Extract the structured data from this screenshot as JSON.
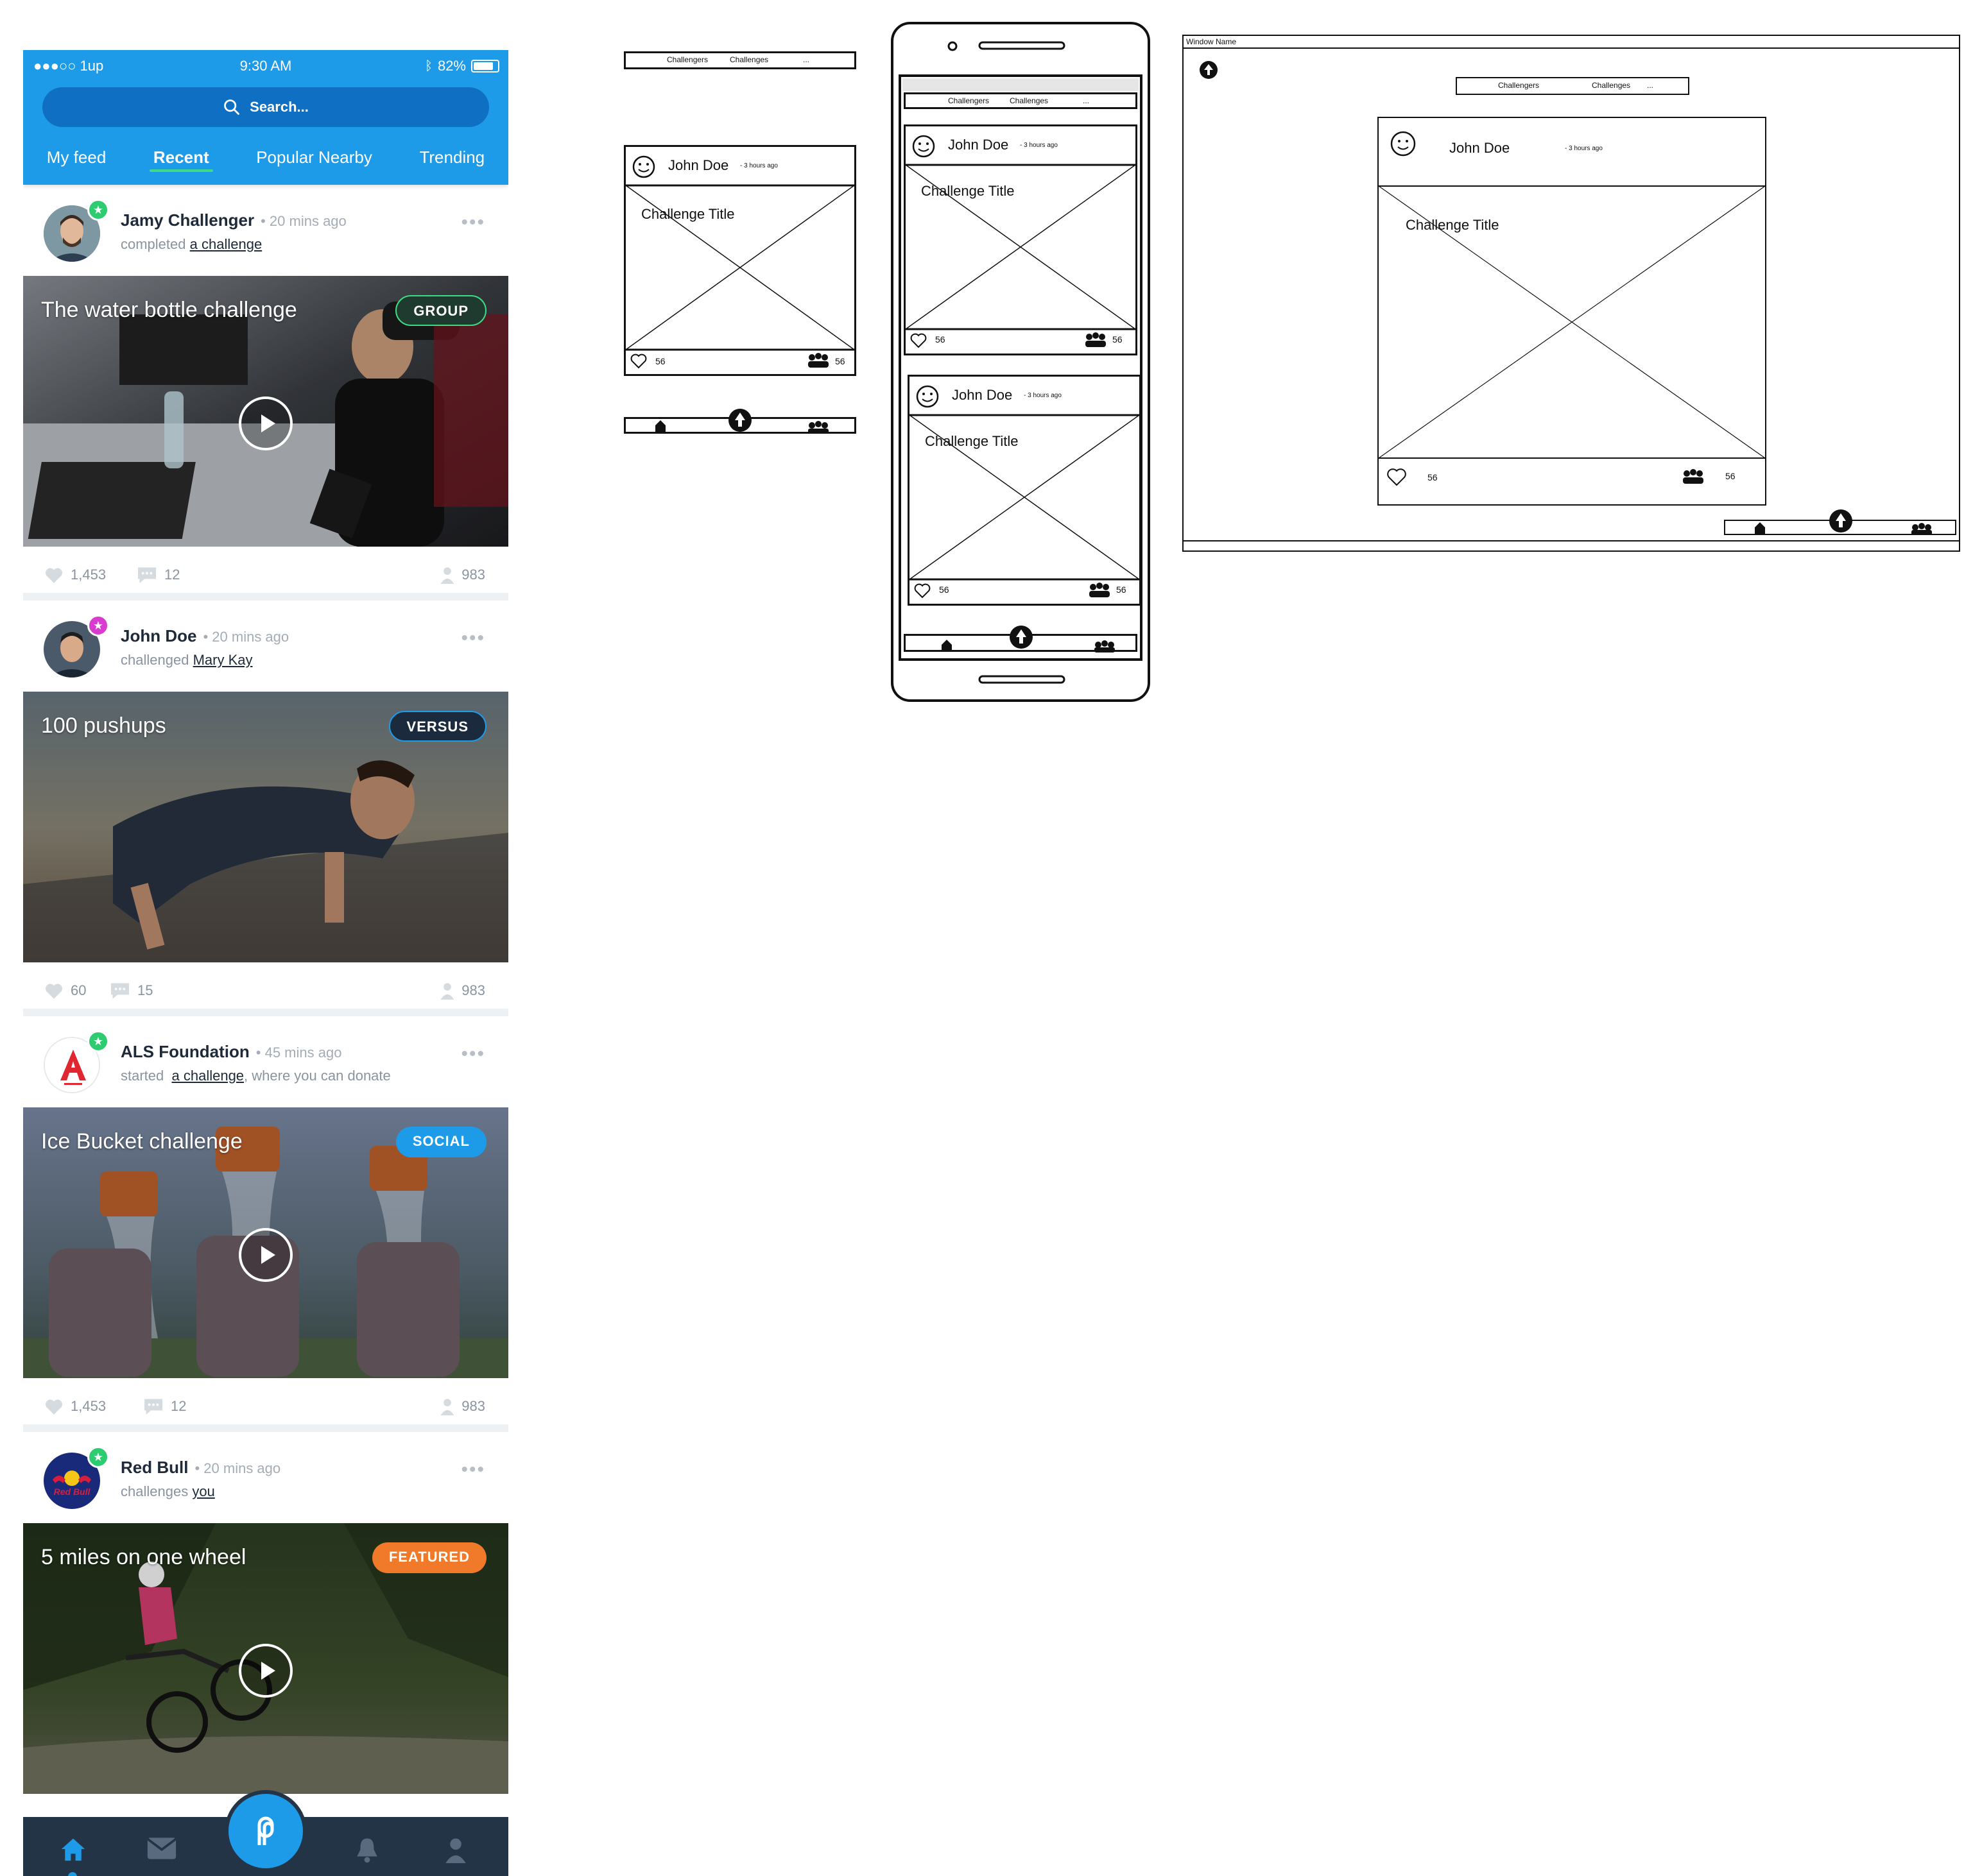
{
  "status_bar": {
    "carrier": "●●●○○ 1up",
    "time": "9:30 AM",
    "battery": "82%",
    "battery_level": 0.82
  },
  "search": {
    "placeholder": "Search..."
  },
  "tabs": [
    {
      "label": "My feed"
    },
    {
      "label": "Recent",
      "active": true
    },
    {
      "label": "Popular Nearby"
    },
    {
      "label": "Trending"
    }
  ],
  "posts": [
    {
      "name": "Jamy Challenger",
      "time": "20 mins ago",
      "action_prefix": "completed",
      "action_link": "a challenge",
      "action_suffix": "",
      "title": "The water bottle challenge",
      "tag": "GROUP",
      "tag_color": "#1f3a2e",
      "likes": "1,453",
      "comments": "12",
      "participants": "983",
      "badge_color": "#2ecc71"
    },
    {
      "name": "John Doe",
      "time": "20 mins ago",
      "action_prefix": "challenged",
      "action_link": "Mary Kay",
      "action_suffix": "",
      "title": "100 pushups",
      "tag": "VERSUS",
      "tag_color": "#1b2a3d",
      "likes": "60",
      "comments": "15",
      "participants": "983",
      "badge_color": "#d93bd0"
    },
    {
      "name": "ALS Foundation",
      "time": "45 mins ago",
      "action_prefix": "started",
      "action_link": "a challenge",
      "action_suffix": ", where you can donate",
      "title": "Ice Bucket challenge",
      "tag": "SOCIAL",
      "tag_color": "#1e9be8",
      "likes": "1,453",
      "comments": "12",
      "participants": "983",
      "badge_color": "#2ecc71"
    },
    {
      "name": "Red Bull",
      "time": "20 mins ago",
      "action_prefix": "challenges",
      "action_link": "you",
      "action_suffix": "",
      "title": "5 miles on one wheel",
      "tag": "FEATURED",
      "tag_color": "#f07a2a",
      "badge_color": "#2ecc71"
    }
  ],
  "nav": {
    "items": [
      "home-icon",
      "mail-icon",
      "challenge-fab-icon",
      "bell-icon",
      "profile-icon"
    ]
  },
  "wireframes": {
    "tabs": {
      "challengers": "Challengers",
      "challenges": "Challenges",
      "more": "..."
    },
    "card": {
      "user": "John Doe",
      "time": "- 3 hours ago",
      "title": "Challenge Title",
      "likes": "56",
      "participants": "56"
    },
    "window_name": "Window Name"
  },
  "colors": {
    "brand_blue": "#1e9be8",
    "nav_dark": "#243447",
    "active_tab_underline": "#3ddc84"
  }
}
